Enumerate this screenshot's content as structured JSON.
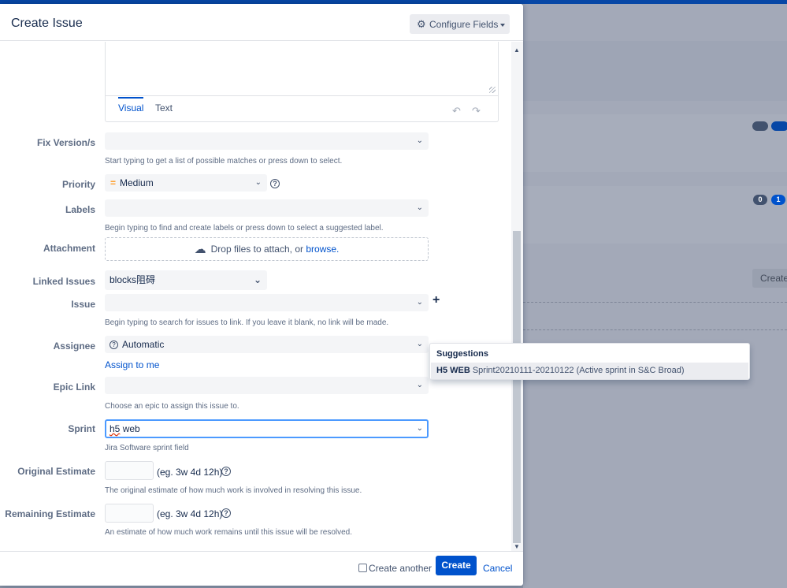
{
  "dialog": {
    "title": "Create Issue",
    "configure_fields": "Configure Fields"
  },
  "editor": {
    "tab_visual": "Visual",
    "tab_text": "Text",
    "undo_icon": "undo-icon",
    "redo_icon": "redo-icon"
  },
  "fix_version": {
    "label": "Fix Version/s",
    "value": "",
    "hint": "Start typing to get a list of possible matches or press down to select."
  },
  "priority": {
    "label": "Priority",
    "value": "Medium",
    "color": "#ff991f"
  },
  "labels": {
    "label": "Labels",
    "value": "",
    "hint": "Begin typing to find and create labels or press down to select a suggested label."
  },
  "attachment": {
    "label": "Attachment",
    "drop_text": "Drop files to attach, or",
    "browse": "browse."
  },
  "linked_issues": {
    "label": "Linked Issues",
    "value": "blocks阻碍"
  },
  "issue": {
    "label": "Issue",
    "value": "",
    "hint": "Begin typing to search for issues to link. If you leave it blank, no link will be made."
  },
  "assignee": {
    "label": "Assignee",
    "value": "Automatic",
    "assign_to_me": "Assign to me"
  },
  "epic_link": {
    "label": "Epic Link",
    "value": "",
    "hint": "Choose an epic to assign this issue to."
  },
  "sprint": {
    "label": "Sprint",
    "value_prefix": "h5",
    "value_rest": " web",
    "hint": "Jira Software sprint field"
  },
  "original_estimate": {
    "label": "Original Estimate",
    "value": "",
    "example": "(eg. 3w 4d 12h)",
    "hint": "The original estimate of how much work is involved in resolving this issue."
  },
  "remaining_estimate": {
    "label": "Remaining Estimate",
    "value": "",
    "example": "(eg. 3w 4d 12h)",
    "hint": "An estimate of how much work remains until this issue will be resolved."
  },
  "suggestions": {
    "heading": "Suggestions",
    "items": [
      {
        "key": "H5 WEB",
        "name": "Sprint20210111-20210122",
        "state": "(Active sprint in S&C Broad)"
      }
    ]
  },
  "footer": {
    "create_another": "Create another",
    "create": "Create",
    "cancel": "Cancel"
  },
  "background": {
    "badge_a": "0",
    "badge_b": "1",
    "create_button": "Create"
  },
  "colors": {
    "primary": "#0052cc",
    "focus": "#4c9aff",
    "header_bar": "#0747a6"
  }
}
